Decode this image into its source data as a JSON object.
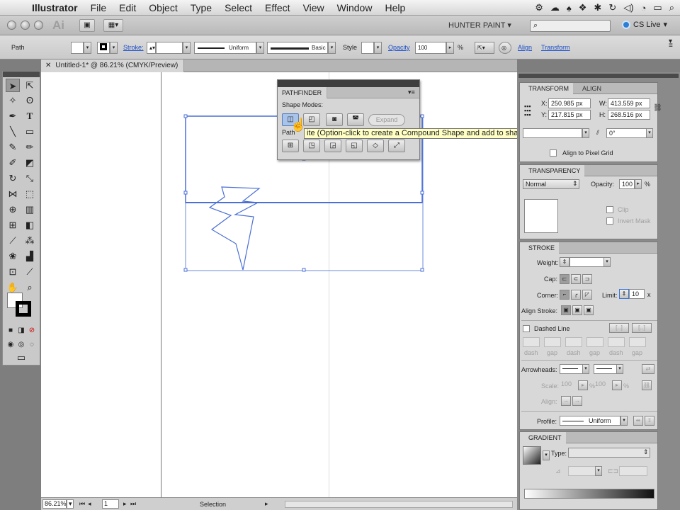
{
  "menubar": {
    "app_name": "Illustrator",
    "items": [
      "File",
      "Edit",
      "Object",
      "Type",
      "Select",
      "Effect",
      "View",
      "Window",
      "Help"
    ]
  },
  "appbar": {
    "logo": "Ai",
    "workspace": "HUNTER PAINT",
    "search_placeholder": "",
    "cs_live": "CS Live"
  },
  "control": {
    "object_type": "Path",
    "stroke_label": "Stroke:",
    "stroke_profile": "Uniform",
    "brush": "Basic",
    "style_label": "Style",
    "opacity_label": "Opacity",
    "opacity_value": "100",
    "percent": "%",
    "align_label": "Align",
    "transform_label": "Transform"
  },
  "document": {
    "tab_title": "Untitled-1* @ 86.21% (CMYK/Preview)",
    "close_glyph": "✕"
  },
  "pathfinder": {
    "title": "PATHFINDER",
    "shape_modes_label": "Shape Modes:",
    "pathfinders_label": "Path",
    "expand_label": "Expand",
    "tooltip": "ite (Option-click to create a Compound Shape and add to shape area)"
  },
  "transform": {
    "tab_transform": "TRANSFORM",
    "tab_align": "ALIGN",
    "x_label": "X:",
    "x_value": "250.985 px",
    "y_label": "Y:",
    "y_value": "217.815 px",
    "w_label": "W:",
    "w_value": "413.559 px",
    "h_label": "H:",
    "h_value": "268.516 px",
    "shear_value": "0°",
    "align_pixel_grid": "Align to Pixel Grid"
  },
  "transparency": {
    "title": "TRANSPARENCY",
    "blend_mode": "Normal",
    "opacity_label": "Opacity:",
    "opacity_value": "100",
    "percent": "%",
    "clip": "Clip",
    "invert_mask": "Invert Mask"
  },
  "stroke": {
    "title": "STROKE",
    "weight_label": "Weight:",
    "cap_label": "Cap:",
    "corner_label": "Corner:",
    "limit_label": "Limit:",
    "limit_value": "10",
    "limit_unit": "x",
    "align_stroke_label": "Align Stroke:",
    "dashed_line": "Dashed Line",
    "dash_labels": [
      "dash",
      "gap",
      "dash",
      "gap",
      "dash",
      "gap"
    ],
    "arrowheads_label": "Arrowheads:",
    "scale_label": "Scale:",
    "scale_1": "100",
    "scale_2": "100",
    "scale_percent": "%",
    "align_label": "Align:",
    "profile_label": "Profile:",
    "profile_value": "Uniform"
  },
  "gradient": {
    "title": "GRADIENT",
    "type_label": "Type:"
  },
  "status": {
    "zoom": "86.21%",
    "artboard": "1",
    "tool": "Selection"
  },
  "colors": {
    "selection_blue": "#4a6fd6",
    "link_blue": "#1a4fc9",
    "tooltip_bg": "#ffffc4"
  }
}
